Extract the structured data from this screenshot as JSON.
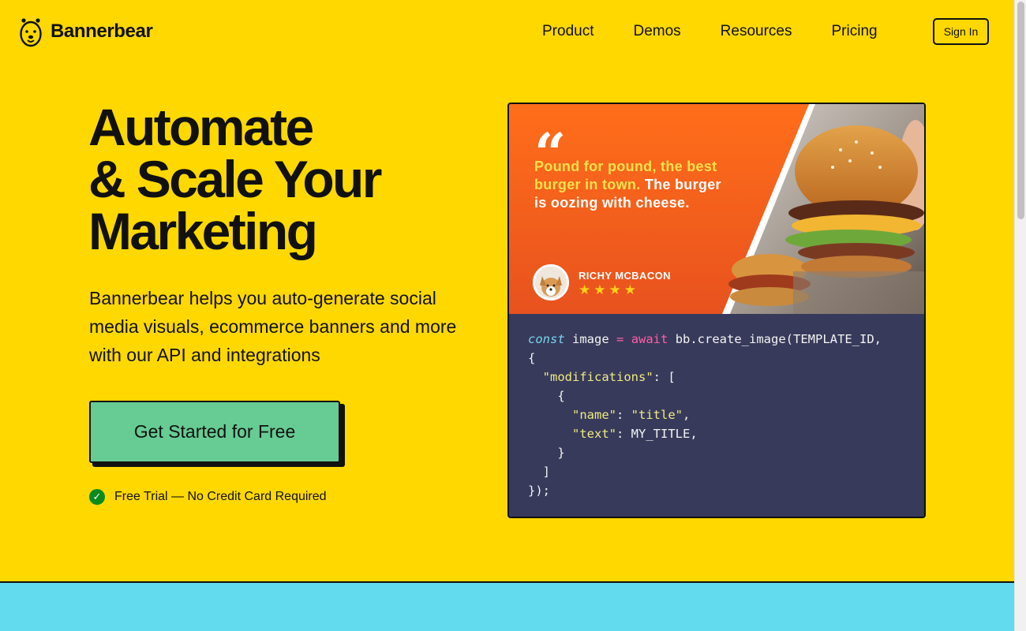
{
  "header": {
    "logo_text": "Bannerbear",
    "nav": [
      "Product",
      "Demos",
      "Resources",
      "Pricing"
    ],
    "sign_in": "Sign In"
  },
  "hero": {
    "title_lines": [
      "Automate",
      "& Scale Your",
      "Marketing"
    ],
    "subtitle": "Bannerbear helps you auto-generate social media visuals, ecommerce banners and more with our API and integrations",
    "cta": "Get Started for Free",
    "trial_note": "Free Trial — No Credit Card Required",
    "trial_icon": "check-icon"
  },
  "banner": {
    "quote_mark": "“",
    "quote_highlight": "Pound for pound, the best burger in town.",
    "quote_rest": "The burger is oozing with cheese.",
    "author": "RICHY MCBACON",
    "rating": 4,
    "stars": [
      "★",
      "★",
      "★",
      "★"
    ]
  },
  "code": {
    "lines": [
      [
        {
          "t": "const",
          "c": "kw-const"
        },
        {
          "t": " image "
        },
        {
          "t": "=",
          "c": "kw-op"
        },
        {
          "t": " "
        },
        {
          "t": "await",
          "c": "kw-await"
        },
        {
          "t": " bb.create_image(TEMPLATE_ID,"
        }
      ],
      [
        {
          "t": "{"
        }
      ],
      [
        {
          "t": "  "
        },
        {
          "t": "\"modifications\"",
          "c": "str"
        },
        {
          "t": ": ["
        }
      ],
      [
        {
          "t": "    {"
        }
      ],
      [
        {
          "t": "      "
        },
        {
          "t": "\"name\"",
          "c": "str"
        },
        {
          "t": ": "
        },
        {
          "t": "\"title\"",
          "c": "str"
        },
        {
          "t": ","
        }
      ],
      [
        {
          "t": "      "
        },
        {
          "t": "\"text\"",
          "c": "str"
        },
        {
          "t": ": MY_TITLE,"
        }
      ],
      [
        {
          "t": "    }"
        }
      ],
      [
        {
          "t": "  ]"
        }
      ],
      [
        {
          "t": "});"
        }
      ]
    ]
  },
  "colors": {
    "background": "#ffd800",
    "cta": "#66cc93",
    "code_bg": "#373a5a",
    "banner_orange": "#ff6e1a",
    "bottom_band": "#62dbee"
  }
}
